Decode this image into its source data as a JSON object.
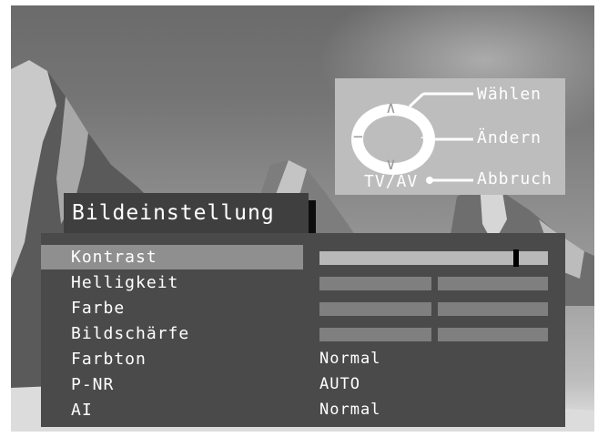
{
  "help": {
    "select_label": "Wählen",
    "change_label": "Ändern",
    "cancel_label": "Abbruch",
    "tvav_label": "TV/AV",
    "icons": {
      "up": "∧",
      "down": "∨",
      "left": "−",
      "right": "+"
    }
  },
  "menu": {
    "title": "Bildeinstellung",
    "items": [
      {
        "label": "Kontrast",
        "type": "slider",
        "level": 0.86,
        "selected": true
      },
      {
        "label": "Helligkeit",
        "type": "slider-split"
      },
      {
        "label": "Farbe",
        "type": "slider-split"
      },
      {
        "label": "Bildschärfe",
        "type": "slider-split"
      },
      {
        "label": "Farbton",
        "type": "text",
        "value": "Normal"
      },
      {
        "label": "P-NR",
        "type": "text",
        "value": "AUTO"
      },
      {
        "label": "AI",
        "type": "text",
        "value": "Normal"
      }
    ]
  },
  "colors": {
    "panel": "#4a4a4a",
    "selected_row": "#8f8f8f",
    "slider_active": "#b8b8b8",
    "slider_inactive": "#7f7f7f",
    "help_panel": "#bdbdbd"
  }
}
